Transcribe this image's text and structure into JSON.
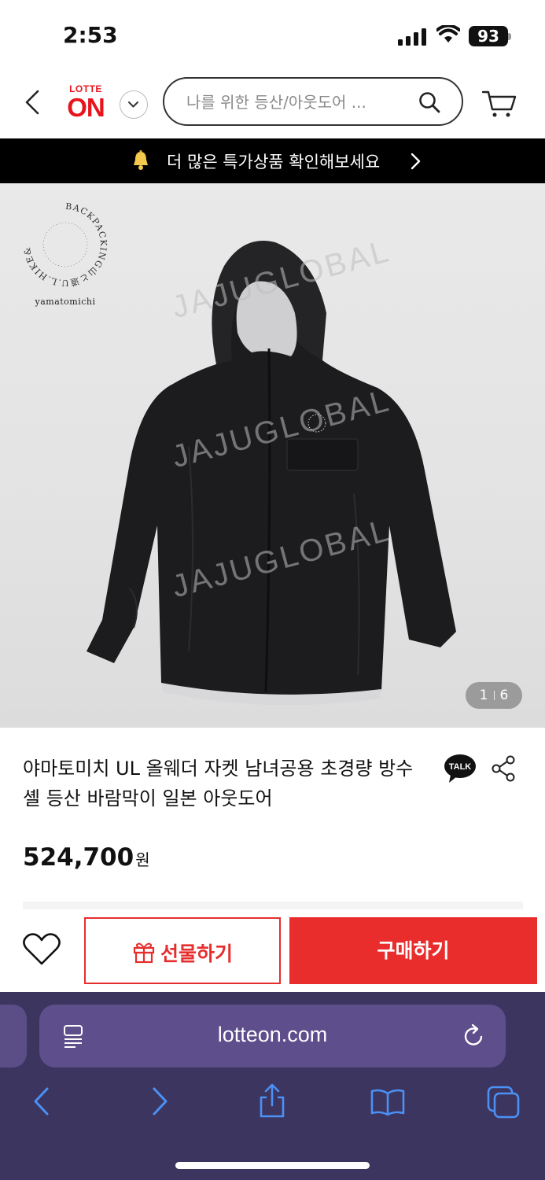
{
  "status": {
    "time": "2:53",
    "battery": "93"
  },
  "header": {
    "logo_top": "LOTTE",
    "logo_main": "ON",
    "search_placeholder": "나를 위한 등산/아웃도어 ..."
  },
  "banner": {
    "text": "더 많은 특가상품 확인해보세요"
  },
  "gallery": {
    "brand_name": "yamatomichi",
    "brand_ring_text": "BACKPACKING山と道U.L.HIKE&",
    "watermark": "JAJUGLOBAL",
    "current": "1",
    "total": "6"
  },
  "product": {
    "title": "야마토미치 UL 올웨더 자켓 남녀공용 초경량 방수 셸 등산 바람막이 일본 아웃도어",
    "price": "524,700",
    "currency": "원"
  },
  "actions": {
    "gift_label": "선물하기",
    "buy_label": "구매하기"
  },
  "browser": {
    "url": "lotteon.com"
  },
  "colors": {
    "brand_red": "#e8141c",
    "buy_red": "#e92c2c",
    "safari_bg": "#3c355f",
    "safari_accent": "#4a90f5"
  }
}
